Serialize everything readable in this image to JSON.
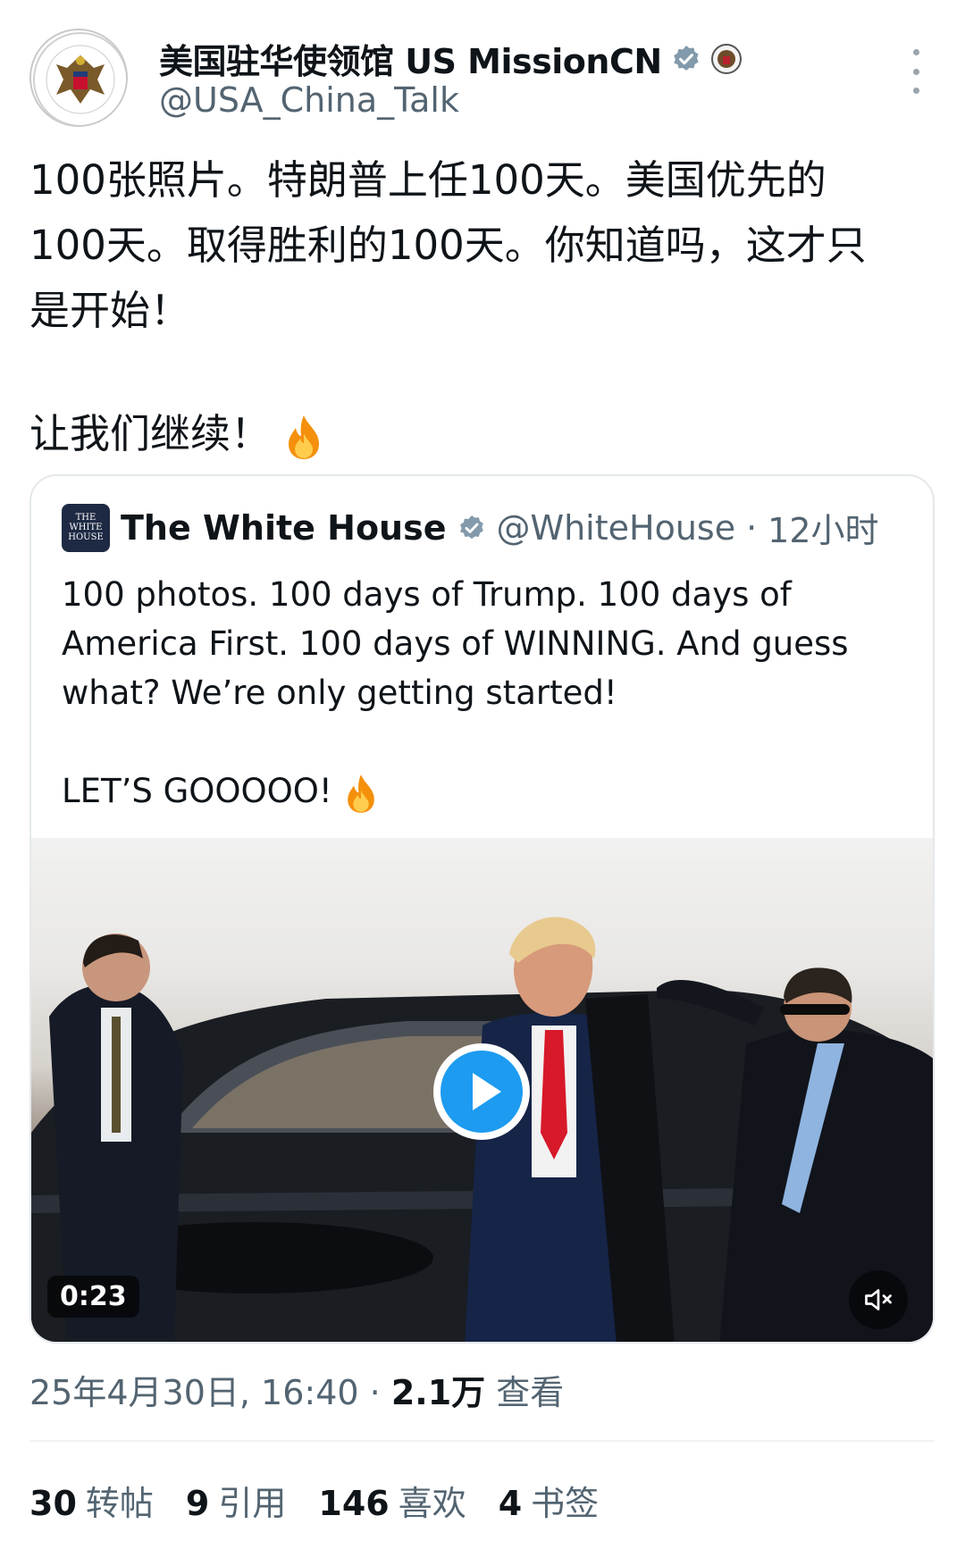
{
  "account": {
    "display_name": "美国驻华使领馆 US MissionCN",
    "handle": "@USA_China_Talk",
    "verified_badge_color": "#829aab"
  },
  "tweet": {
    "lines": [
      "100张照片。特朗普上任100天。美国优先的",
      "100天。取得胜利的100天。你知道吗，这才只",
      "是开始！"
    ],
    "line2": "让我们继续！",
    "emoji": "fire-emoji"
  },
  "quote": {
    "name": "The White House",
    "handle": "@WhiteHouse",
    "separator": "·",
    "time": "12小时",
    "logo_text": [
      "THE",
      "WHITE",
      "HOUSE"
    ],
    "lines": [
      "100 photos. 100 days of Trump. 100 days of",
      "America First. 100 days of WINNING. And guess",
      "what? We’re only getting started!"
    ],
    "line2": "LET’S GOOOOO!",
    "video": {
      "duration": "0:23",
      "play_color": "#1d9bf0"
    }
  },
  "meta": {
    "date": "25年4月30日, 16:40",
    "separator": "·",
    "views": "2.1万",
    "views_label": "查看"
  },
  "stats": [
    {
      "count": "30",
      "label": "转帖"
    },
    {
      "count": "9",
      "label": "引用"
    },
    {
      "count": "146",
      "label": "喜欢"
    },
    {
      "count": "4",
      "label": "书签"
    }
  ]
}
